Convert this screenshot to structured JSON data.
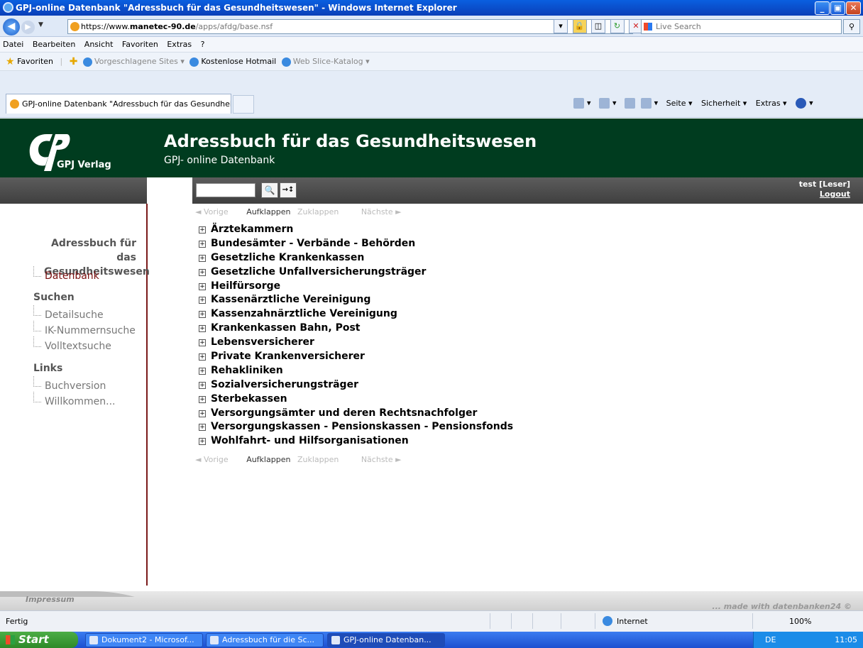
{
  "window": {
    "title": "GPJ-online Datenbank \"Adressbuch für das Gesundheitswesen\" - Windows Internet Explorer",
    "min": "_",
    "max": "▣",
    "close": "✕"
  },
  "address": {
    "scheme": "https://www.",
    "host": "manetec-90.de",
    "path": "/apps/afdg/base.nsf",
    "search_placeholder": "Live Search"
  },
  "menu": [
    "Datei",
    "Bearbeiten",
    "Ansicht",
    "Favoriten",
    "Extras",
    "?"
  ],
  "favorites": {
    "label": "Favoriten",
    "items": [
      "Vorgeschlagene Sites ▾",
      "Kostenlose Hotmail",
      "Web Slice-Katalog ▾"
    ]
  },
  "tab": {
    "label": "GPJ-online Datenbank \"Adressbuch für das Gesundhei..."
  },
  "commandbar": {
    "items": [
      "Seite ▾",
      "Sicherheit ▾",
      "Extras ▾"
    ]
  },
  "header": {
    "logo_text": "GPJ Verlag",
    "title": "Adressbuch für das Gesundheitswesen",
    "subtitle": "GPJ- online Datenbank"
  },
  "toolbar": {
    "search_btn": "🔍",
    "sort_btn": "→↕",
    "user": "test  [Leser]",
    "logout": "Logout"
  },
  "sidebar": {
    "section1": "Adressbuch für das Gesundheitswesen",
    "section1_items": [
      "Datenbank"
    ],
    "section2": "Suchen",
    "section2_items": [
      "Detailsuche",
      "IK-Nummernsuche",
      "Volltextsuche"
    ],
    "section3": "Links",
    "section3_items": [
      "Buchversion",
      "Willkommen..."
    ]
  },
  "pager": {
    "prev": "◄ Vorige",
    "expand": "Aufklappen",
    "collapse": "Zuklappen",
    "next": "Nächste ►"
  },
  "categories": [
    "Ärztekammern",
    "Bundesämter - Verbände - Behörden",
    "Gesetzliche Krankenkassen",
    "Gesetzliche Unfallversicherungsträger",
    "Heilfürsorge",
    "Kassenärztliche Vereinigung",
    "Kassenzahnärztliche Vereinigung",
    "Krankenkassen Bahn, Post",
    "Lebensversicherer",
    "Private Krankenversicherer",
    "Rehakliniken",
    "Sozialversicherungsträger",
    "Sterbekassen",
    "Versorgungsämter und deren Rechtsnachfolger",
    "Versorgungskassen - Pensionskassen - Pensionsfonds",
    "Wohlfahrt- und Hilfsorganisationen"
  ],
  "footer": {
    "impressum": "Impressum",
    "made_with": "... made with datenbanken24 ©"
  },
  "status": {
    "text": "Fertig",
    "zone": "Internet",
    "zoom": "100%"
  },
  "taskbar": {
    "start": "Start",
    "items": [
      "Dokument2 - Microsof...",
      "Adressbuch für die Sc...",
      "GPJ-online Datenban..."
    ],
    "lang": "DE",
    "clock": "11:05"
  },
  "colors": {
    "header_green": "#003c1f",
    "sidebar_accent": "#7a1010"
  }
}
